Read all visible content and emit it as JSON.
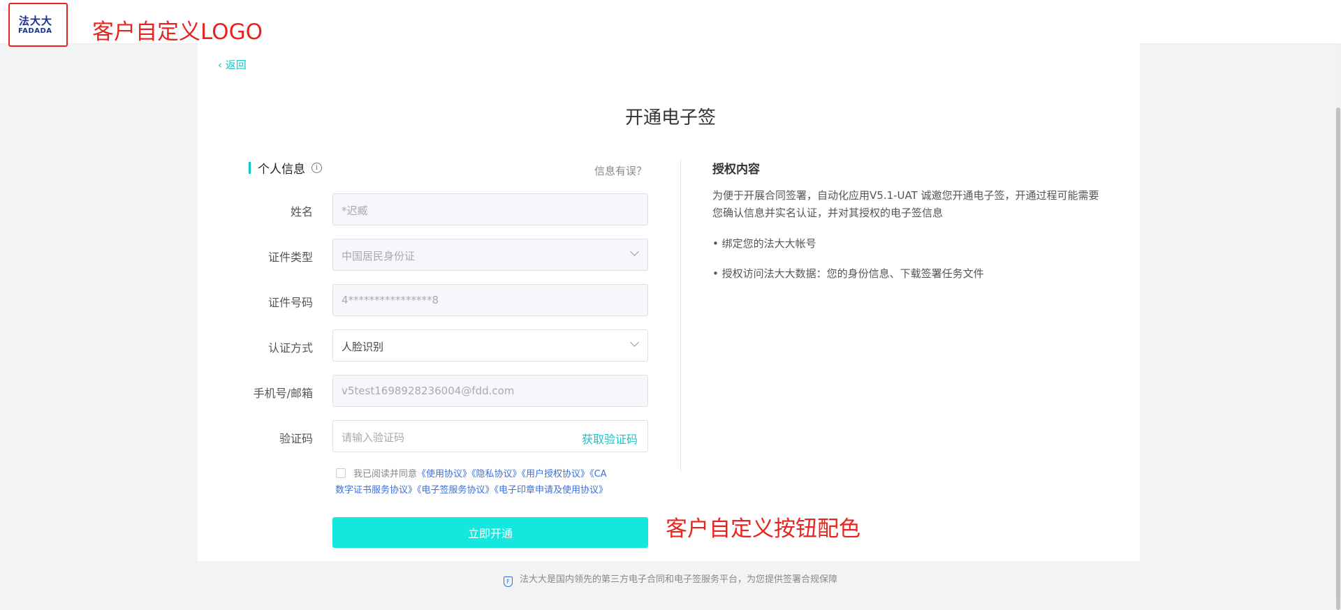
{
  "header": {
    "logo_cn": "法大大",
    "logo_en": "FADADA",
    "annotation": "客户自定义LOGO"
  },
  "back_label": "返回",
  "page_title": "开通电子签",
  "form": {
    "section_title": "个人信息",
    "info_wrong_link": "信息有误？",
    "fields": [
      {
        "label": "姓名",
        "value": "*迟臧"
      },
      {
        "label": "证件类型",
        "value": "中国居民身份证"
      },
      {
        "label": "证件号码",
        "value": "4****************8"
      },
      {
        "label": "认证方式",
        "value": "人脸识别"
      },
      {
        "label": "手机号/邮箱",
        "value": "v5test1698928236004@fdd.com"
      },
      {
        "label": "验证码",
        "placeholder": "请输入验证码",
        "action": "获取验证码"
      }
    ],
    "agreement": {
      "prefix": "我已阅读并同意",
      "links": [
        "《使用协议》",
        "《隐私协议》",
        "《用户授权协议》",
        "《CA",
        "数字证书服务协议》",
        "《电子签服务协议》",
        "《电子印章申请及使用协议》"
      ]
    },
    "submit_label": "立即开通",
    "submit_annotation": "客户自定义按钮配色"
  },
  "auth": {
    "title": "授权内容",
    "description": "为便于开展合同签署，自动化应用V5.1-UAT 诚邀您开通电子签，开通过程可能需要您确认信息并实名认证，并对其授权的电子签信息",
    "items": [
      "• 绑定您的法大大帐号",
      "• 授权访问法大大数据：您的身份信息、下载签署任务文件"
    ]
  },
  "footer_text": "法大大是国内领先的第三方电子合同和电子签服务平台，为您提供签署合规保障",
  "colors": {
    "accent": "#16c5c5",
    "button": "#14e8de",
    "annotation": "#e8241f",
    "link": "#3c6fd9"
  }
}
